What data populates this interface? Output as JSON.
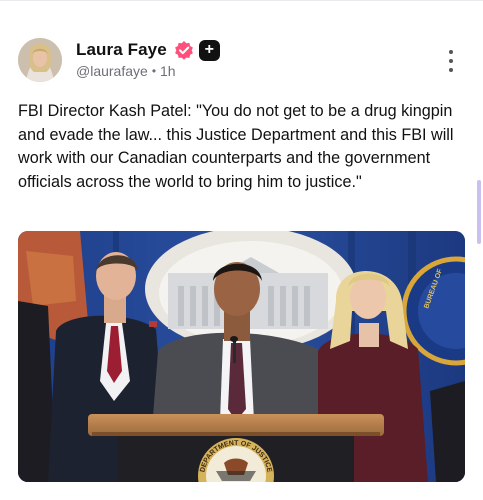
{
  "post": {
    "author_name": "Laura Faye",
    "handle": "@laurafaye",
    "separator": "•",
    "time_ago": "1h",
    "body": "FBI Director Kash Patel: \"You do not get to be a drug kingpin and evade the law... this Justice Department and this FBI will work with our Canadian counterparts and the government officials across the world to bring him to justice.\"",
    "follow_button_glyph": "+",
    "verified_badge_icon": "verified-badge-icon",
    "menu_icon": "more-vertical-icon"
  },
  "media": {
    "seal_lettering": "DEPARTMENT OF JUSTICE",
    "fbi_seal_lettering": "BUREAU OF"
  },
  "colors": {
    "verified_badge": "#ff4f7b",
    "follow_button": "#111111",
    "scrollbar": "#c9c0f0",
    "handle_text": "#6e6e78"
  }
}
